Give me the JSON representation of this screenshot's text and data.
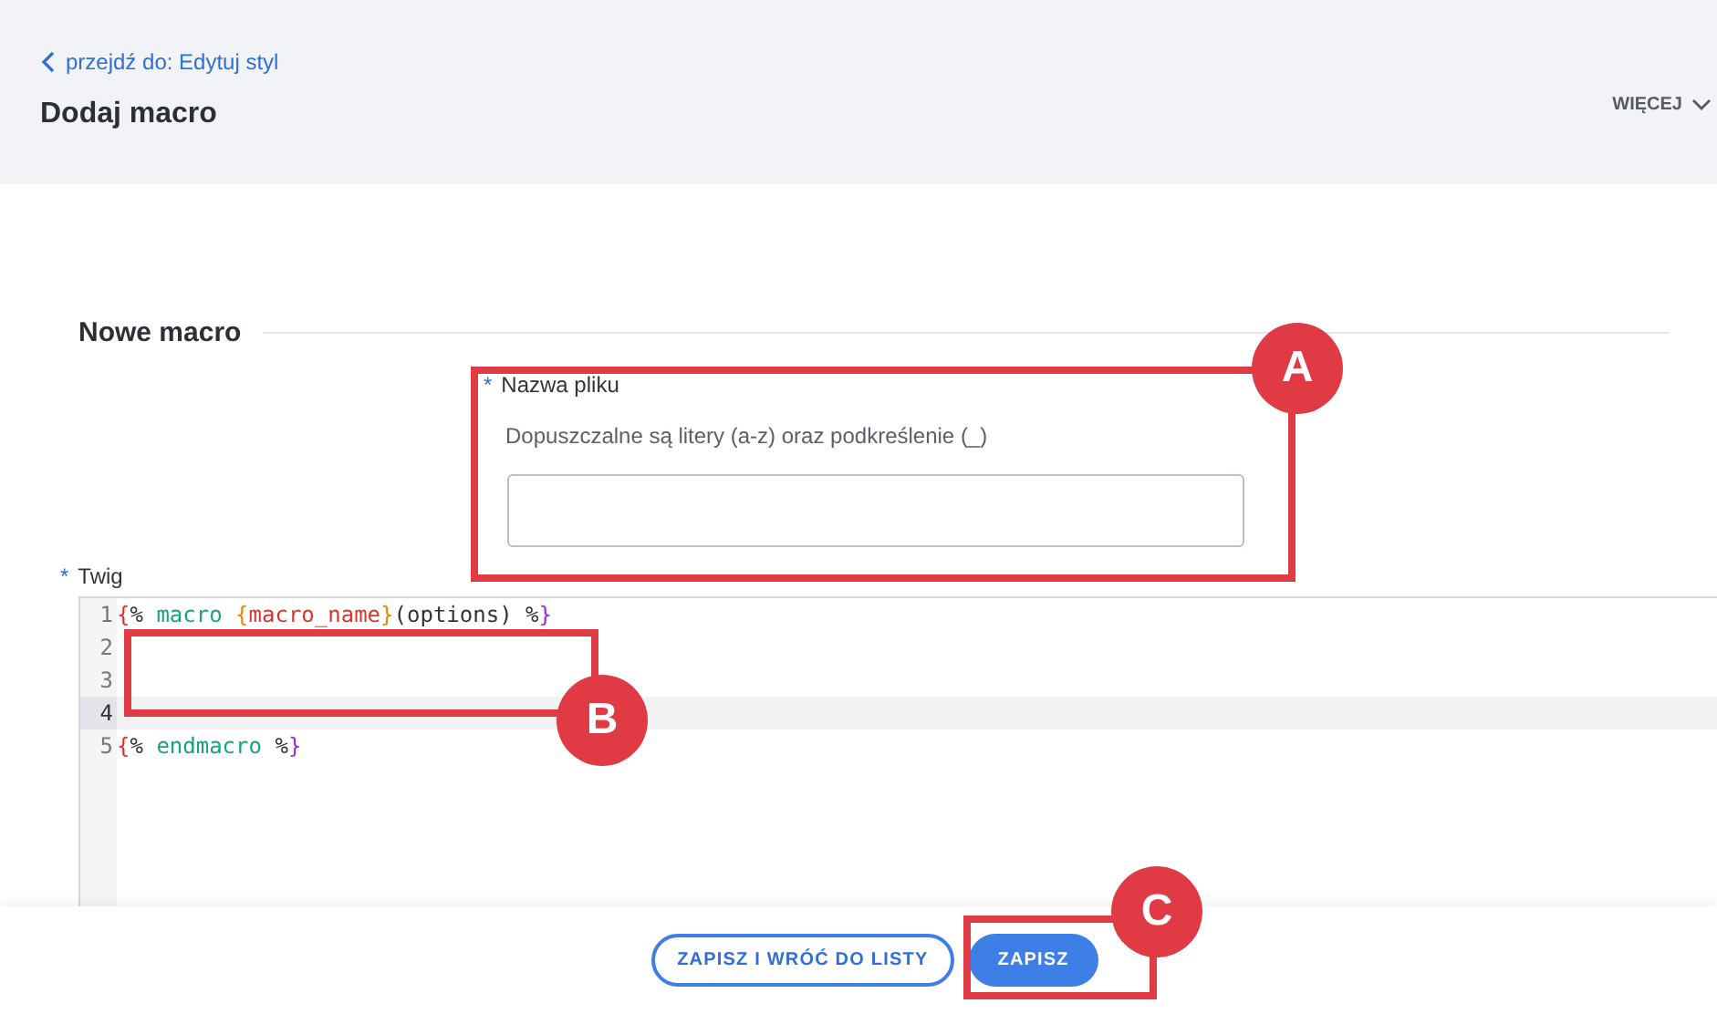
{
  "header": {
    "back_link": "przejdź do: Edytuj styl",
    "title": "Dodaj macro",
    "more_menu": "WIĘCEJ"
  },
  "section": {
    "title": "Nowe macro"
  },
  "filename_field": {
    "required_mark": "*",
    "label": "Nazwa pliku",
    "hint": "Dopuszczalne są litery (a-z) oraz podkreślenie (_)"
  },
  "twig_field": {
    "required_mark": "*",
    "label": "Twig"
  },
  "editor": {
    "lines": [
      {
        "number": "1",
        "active": false,
        "tokens": [
          {
            "kind": "bracket",
            "text": "{"
          },
          {
            "kind": "plain",
            "text": "% "
          },
          {
            "kind": "keyword",
            "text": "macro "
          },
          {
            "kind": "var",
            "text": "{"
          },
          {
            "kind": "varname",
            "text": "macro_name"
          },
          {
            "kind": "var",
            "text": "}"
          },
          {
            "kind": "plain",
            "text": "(options) %"
          },
          {
            "kind": "bracket2",
            "text": "}"
          }
        ]
      },
      {
        "number": "2",
        "active": false
      },
      {
        "number": "3",
        "active": false
      },
      {
        "number": "4",
        "active": true
      },
      {
        "number": "5",
        "active": false,
        "tokens": [
          {
            "kind": "bracket",
            "text": "{"
          },
          {
            "kind": "plain",
            "text": "% "
          },
          {
            "kind": "keyword",
            "text": "endmacro "
          },
          {
            "kind": "plain",
            "text": "%"
          },
          {
            "kind": "bracket2",
            "text": "}"
          }
        ]
      }
    ]
  },
  "footer": {
    "buttons": [
      {
        "label": "ZAPISZ I WRÓĆ DO LISTY",
        "kind": "outline"
      },
      {
        "label": "ZAPISZ",
        "kind": "primary"
      }
    ]
  },
  "annotations": [
    {
      "letter": "A"
    },
    {
      "letter": "B"
    },
    {
      "letter": "C"
    }
  ]
}
